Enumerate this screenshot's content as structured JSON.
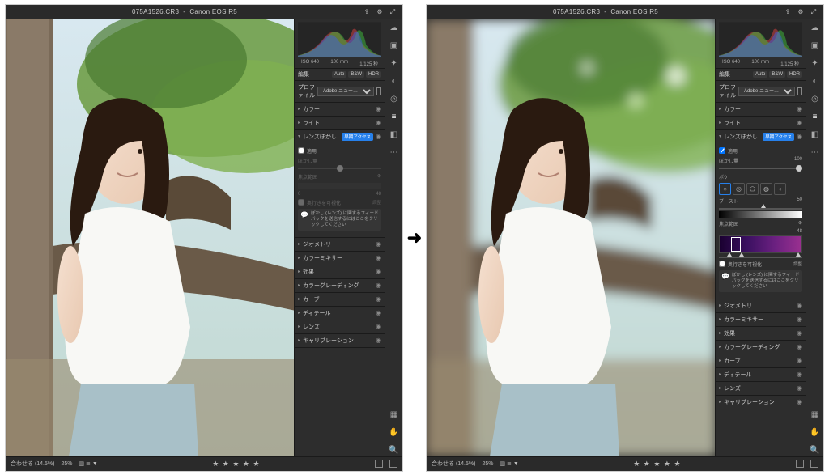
{
  "doc": {
    "filename": "075A1526.CR3",
    "camera": "Canon EOS R5"
  },
  "meta": {
    "iso": "ISO 640",
    "focal": "100 mm",
    "shutter": "1/125 秒"
  },
  "mode": {
    "edit": "編集",
    "auto": "Auto",
    "bw": "B&W",
    "hdr": "HDR"
  },
  "profile": {
    "label": "プロファイル",
    "value": "Adobe ニュー…"
  },
  "sections": {
    "color": "カラー",
    "light": "ライト",
    "lensblur": "レンズぼかし",
    "geometry": "ジオメトリ",
    "colormix": "カラーミキサー",
    "effects": "効果",
    "colorgrade": "カラーグレーディング",
    "curve": "カーブ",
    "detail": "ディテール",
    "lens": "レンズ",
    "calib": "キャリブレーション"
  },
  "lensblur": {
    "badge": "早期アクセス",
    "apply": "適用",
    "amount_label": "ぼかし量",
    "amount_val": "100",
    "bokeh_label": "ボケ",
    "boost_label": "ブースト",
    "boost_val": "50",
    "focal_label": "焦点範囲",
    "focal_val": "48",
    "visualize": "奥行きを可視化",
    "refine": "調整",
    "feedback": "ぼかし (レンズ) に関するフィードバックを送信するにはここをクリックしてください",
    "left_slider_val": "0"
  },
  "bottom": {
    "fit": "合わせる (14.5%)",
    "zoom": "25%"
  },
  "arrow": "➜"
}
